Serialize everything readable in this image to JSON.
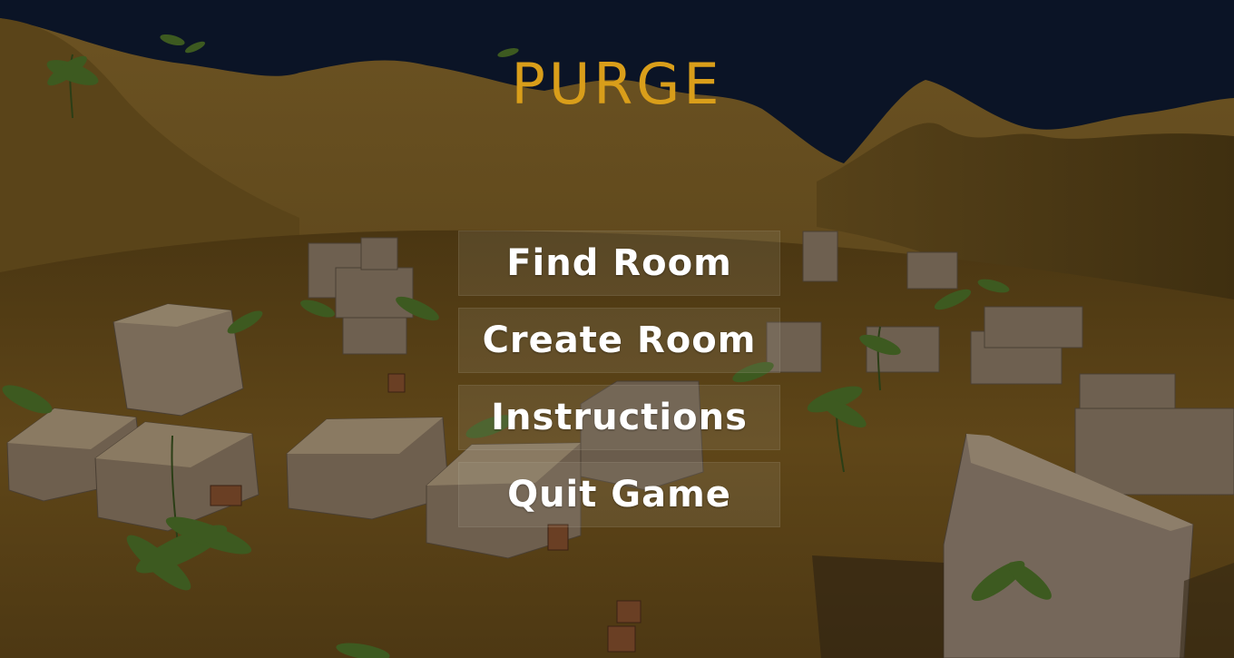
{
  "game": {
    "title": "PURGE",
    "title_color": "#d99e1a"
  },
  "menu": {
    "find_room": "Find Room",
    "create_room": "Create Room",
    "instructions": "Instructions",
    "quit_game": "Quit Game"
  },
  "scene": {
    "sky_color": "#0b1426",
    "sand_color": "#5e4517"
  }
}
